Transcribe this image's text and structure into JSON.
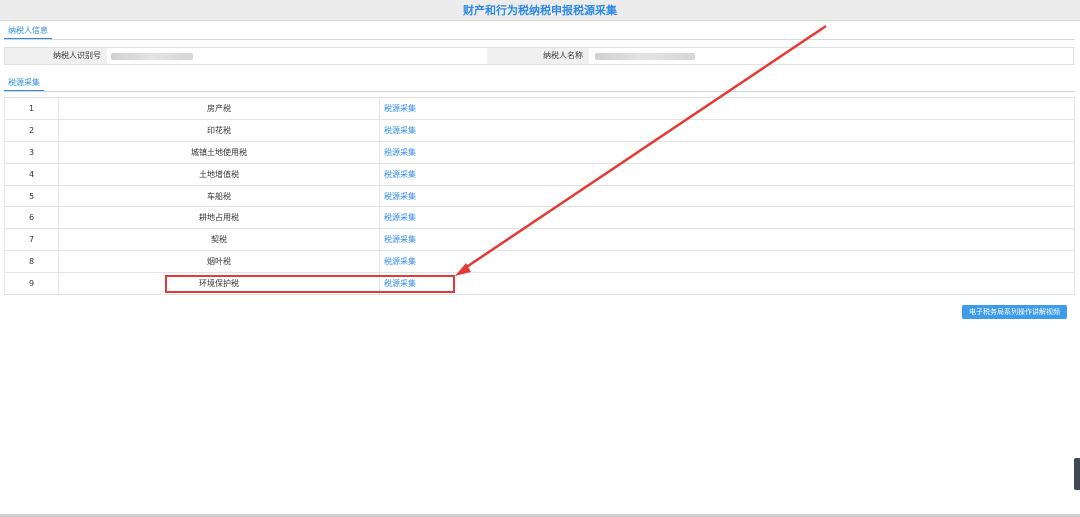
{
  "window": {
    "title": "财产和行为税纳税申报税源采集"
  },
  "taxpayer_section": {
    "tab_label": "纳税人信息",
    "id_label": "纳税人识别号",
    "id_value": "",
    "name_label": "纳税人名称",
    "name_value": ""
  },
  "source_section": {
    "tab_label": "税源采集"
  },
  "rows": [
    {
      "no": "1",
      "name": "房产税",
      "action": "税源采集"
    },
    {
      "no": "2",
      "name": "印花税",
      "action": "税源采集"
    },
    {
      "no": "3",
      "name": "城镇土地使用税",
      "action": "税源采集"
    },
    {
      "no": "4",
      "name": "土地增值税",
      "action": "税源采集"
    },
    {
      "no": "5",
      "name": "车船税",
      "action": "税源采集"
    },
    {
      "no": "6",
      "name": "耕地占用税",
      "action": "税源采集"
    },
    {
      "no": "7",
      "name": "契税",
      "action": "税源采集"
    },
    {
      "no": "8",
      "name": "烟叶税",
      "action": "税源采集"
    },
    {
      "no": "9",
      "name": "环境保护税",
      "action": "税源采集"
    }
  ],
  "video_button": {
    "label": "电子税务局系列操作讲解视频"
  },
  "colors": {
    "accent": "#2e8ae6",
    "annotation": "#e53935",
    "button": "#3d9be9"
  }
}
